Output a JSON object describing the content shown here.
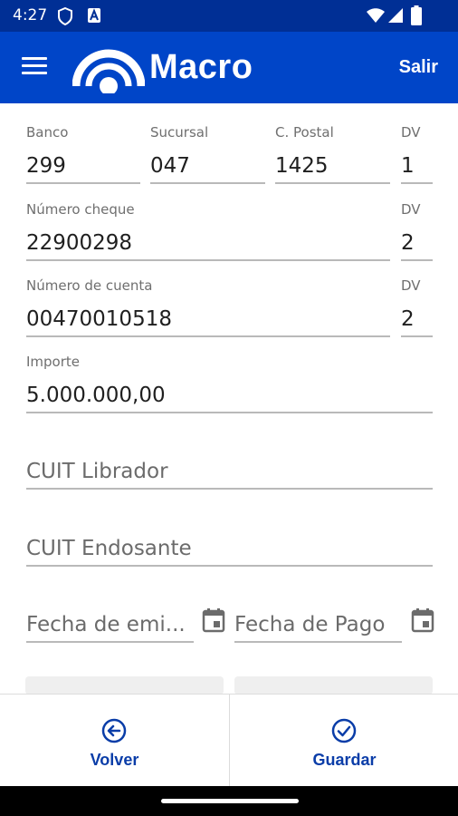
{
  "status_bar": {
    "time": "4:27",
    "icons": [
      "shield-icon",
      "a-badge-icon",
      "wifi-icon",
      "signal-icon",
      "battery-icon"
    ]
  },
  "app_bar": {
    "brand": "Macro",
    "logout_label": "Salir",
    "background": "#0045c8"
  },
  "form": {
    "banco": {
      "label": "Banco",
      "value": "299"
    },
    "sucursal": {
      "label": "Sucursal",
      "value": "047"
    },
    "codigo_postal": {
      "label": "C. Postal",
      "value": "1425"
    },
    "dv1": {
      "label": "DV",
      "value": "1"
    },
    "numero_cheque": {
      "label": "Número cheque",
      "value": "22900298"
    },
    "dv2": {
      "label": "DV",
      "value": "2"
    },
    "numero_cuenta": {
      "label": "Número de cuenta",
      "value": "00470010518"
    },
    "dv3": {
      "label": "DV",
      "value": "2"
    },
    "importe": {
      "label": "Importe",
      "value": "5.000.000,00"
    },
    "cuit_librador": {
      "placeholder": "CUIT Librador"
    },
    "cuit_endosante": {
      "placeholder": "CUIT Endosante"
    },
    "fecha_emision": {
      "placeholder": "Fecha de emi..."
    },
    "fecha_pago": {
      "placeholder": "Fecha de Pago"
    }
  },
  "bottom_bar": {
    "volver_label": "Volver",
    "guardar_label": "Guardar",
    "accent": "#0a3da8"
  }
}
